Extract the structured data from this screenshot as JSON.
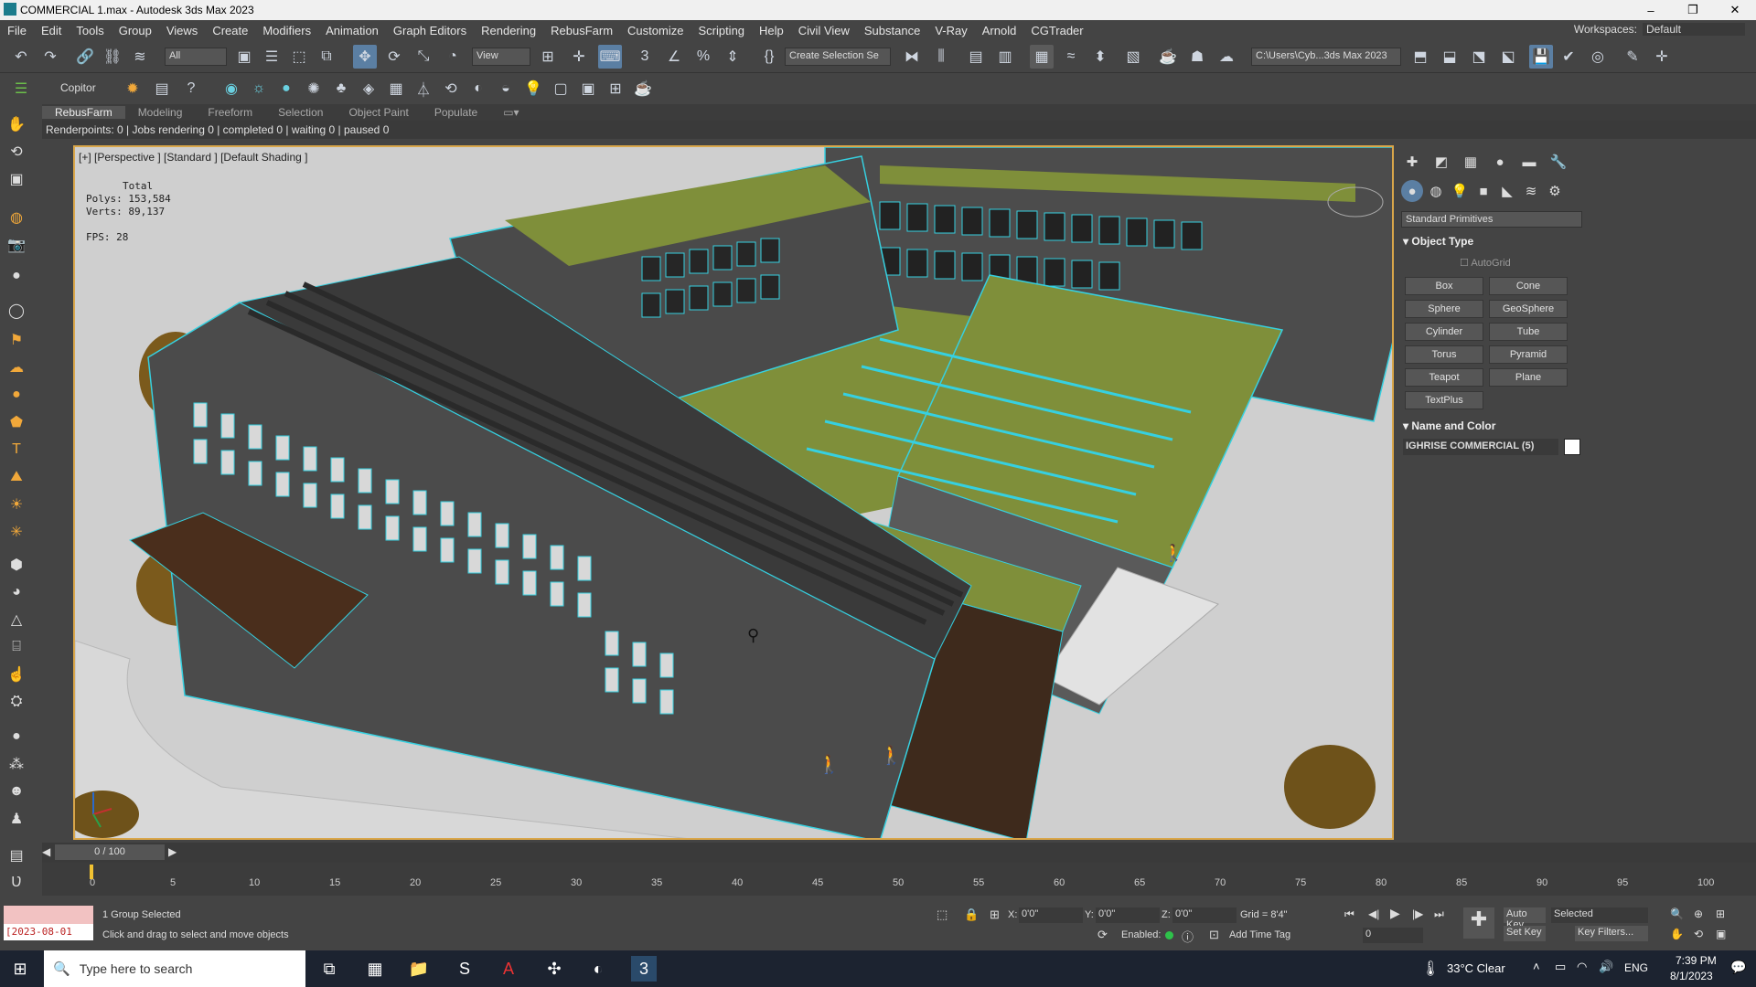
{
  "window": {
    "title": "COMMERCIAL 1.max - Autodesk 3ds Max 2023",
    "min": "–",
    "max": "❐",
    "close": "✕"
  },
  "menu": [
    "File",
    "Edit",
    "Tools",
    "Group",
    "Views",
    "Create",
    "Modifiers",
    "Animation",
    "Graph Editors",
    "Rendering",
    "RebusFarm",
    "Customize",
    "Scripting",
    "Help",
    "Civil View",
    "Substance",
    "V-Ray",
    "Arnold",
    "CGTrader"
  ],
  "workspace": {
    "label": "Workspaces:",
    "value": "Default"
  },
  "toolbar": {
    "filter_value": "All",
    "view_value": "View",
    "selection_set_value": "Create Selection Se",
    "project_path": "C:\\Users\\Cyb...3ds Max 2023"
  },
  "toolbar2": {
    "copitor_label": "Copitor"
  },
  "ribbon_tabs": [
    "RebusFarm",
    "Modeling",
    "Freeform",
    "Selection",
    "Object Paint",
    "Populate"
  ],
  "status_line": "Renderpoints: 0 | Jobs rendering 0 | completed 0 | waiting 0 | paused 0",
  "viewport": {
    "label": "[+] [Perspective ] [Standard ] [Default Shading ]",
    "stats_total": "Total",
    "stats_polys": "Polys:  153,584",
    "stats_verts": "Verts:  89,137",
    "stats_fps": "FPS:   28"
  },
  "command_panel": {
    "dropdown": "Standard Primitives",
    "object_type_header": "Object Type",
    "autogrid": "AutoGrid",
    "buttons": [
      "Box",
      "Cone",
      "Sphere",
      "GeoSphere",
      "Cylinder",
      "Tube",
      "Torus",
      "Pyramid",
      "Teapot",
      "Plane",
      "TextPlus"
    ],
    "name_color_header": "Name and Color",
    "object_name": "IGHRISE COMMERCIAL (5)"
  },
  "timeline": {
    "slider": "0 / 100",
    "ticks": [
      "0",
      "5",
      "10",
      "15",
      "20",
      "25",
      "30",
      "35",
      "40",
      "45",
      "50",
      "55",
      "60",
      "65",
      "70",
      "75",
      "80",
      "85",
      "90",
      "95",
      "100"
    ]
  },
  "bottom": {
    "date_field": "[2023-08-01",
    "selection": "1 Group Selected",
    "prompt": "Click and drag to select and move objects",
    "x_label": "X:",
    "x_value": "0'0\"",
    "y_label": "Y:",
    "y_value": "0'0\"",
    "z_label": "Z:",
    "z_value": "0'0\"",
    "grid": "Grid = 8'4\"",
    "enabled": "Enabled:",
    "add_time_tag": "Add Time Tag",
    "auto_key": "Auto Key",
    "set_key": "Set Key",
    "key_mode": "Selected",
    "key_filters": "Key Filters...",
    "frame": "0"
  },
  "taskbar": {
    "search_placeholder": "Type here to search",
    "weather": "33°C  Clear",
    "lang": "ENG",
    "time": "7:39 PM",
    "date": "8/1/2023"
  },
  "colors": {
    "viewport_border": "#d9a64a",
    "roof": "#7f8f3a",
    "glass": "#36d0e0",
    "wall": "#4a4a4a"
  }
}
